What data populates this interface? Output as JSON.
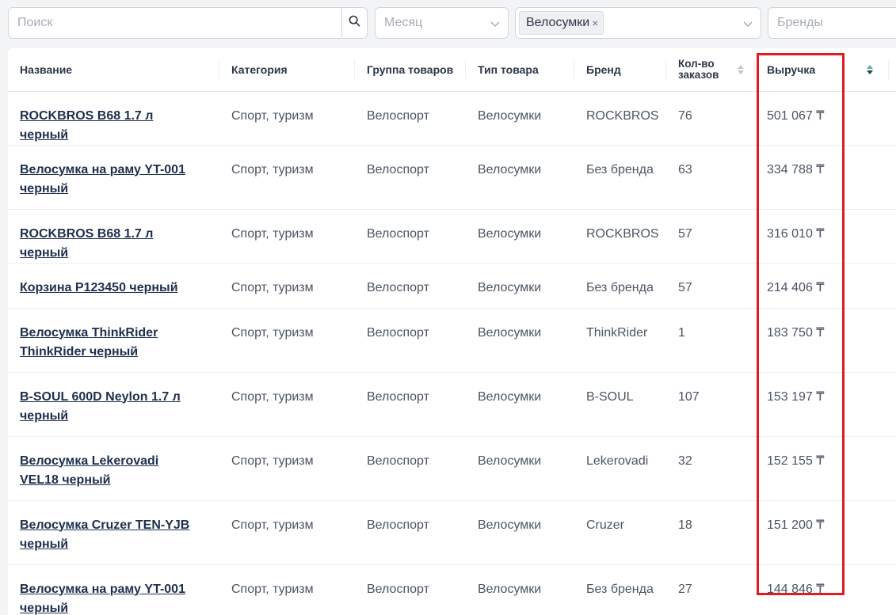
{
  "filters": {
    "search_placeholder": "Поиск",
    "month_placeholder": "Месяц",
    "category_tag": "Велосумки",
    "tag_remove": "×",
    "brands_placeholder": "Бренды"
  },
  "icons": {
    "search": "search-icon",
    "chevron": "chevron-down-icon",
    "sort": "sort-icon"
  },
  "columns": {
    "name": "Название",
    "category": "Категория",
    "group": "Группа товаров",
    "type": "Тип товара",
    "brand": "Бренд",
    "orders": "Кол-во заказов",
    "revenue": "Выручка"
  },
  "rows": [
    {
      "name": "ROCKBROS B68 1.7 л черный",
      "category": "Спорт, туризм",
      "group": "Велоспорт",
      "type": "Велосумки",
      "brand": "ROCKBROS",
      "orders": "76",
      "revenue": "501 067 ₸"
    },
    {
      "name": "Велосумка на раму YT-001 черный",
      "category": "Спорт, туризм",
      "group": "Велоспорт",
      "type": "Велосумки",
      "brand": "Без бренда",
      "orders": "63",
      "revenue": "334 788 ₸"
    },
    {
      "name": "ROCKBROS B68 1.7 л черный",
      "category": "Спорт, туризм",
      "group": "Велоспорт",
      "type": "Велосумки",
      "brand": "ROCKBROS",
      "orders": "57",
      "revenue": "316 010 ₸"
    },
    {
      "name": "Корзина P123450 черный",
      "category": "Спорт, туризм",
      "group": "Велоспорт",
      "type": "Велосумки",
      "brand": "Без бренда",
      "orders": "57",
      "revenue": "214 406 ₸"
    },
    {
      "name": "Велосумка ThinkRider ThinkRider черный",
      "category": "Спорт, туризм",
      "group": "Велоспорт",
      "type": "Велосумки",
      "brand": "ThinkRider",
      "orders": "1",
      "revenue": "183 750 ₸"
    },
    {
      "name": "B-SOUL 600D Neylon 1.7 л черный",
      "category": "Спорт, туризм",
      "group": "Велоспорт",
      "type": "Велосумки",
      "brand": "B-SOUL",
      "orders": "107",
      "revenue": "153 197 ₸"
    },
    {
      "name": "Велосумка Lekerovadi VEL18 черный",
      "category": "Спорт, туризм",
      "group": "Велоспорт",
      "type": "Велосумки",
      "brand": "Lekerovadi",
      "orders": "32",
      "revenue": "152 155 ₸"
    },
    {
      "name": "Велосумка Cruzer TEN-YJB черный",
      "category": "Спорт, туризм",
      "group": "Велоспорт",
      "type": "Велосумки",
      "brand": "Cruzer",
      "orders": "18",
      "revenue": "151 200 ₸"
    },
    {
      "name": "Велосумка на раму YT-001 черный",
      "category": "Спорт, туризм",
      "group": "Велоспорт",
      "type": "Велосумки",
      "brand": "Без бренда",
      "orders": "27",
      "revenue": "144 846 ₸"
    }
  ],
  "sort": {
    "column": "revenue",
    "direction": "descending"
  },
  "highlight": {
    "color": "#e01b24",
    "column": "revenue"
  },
  "colors": {
    "link": "#1e2f4d",
    "sort_active": "#1f4e3a"
  }
}
